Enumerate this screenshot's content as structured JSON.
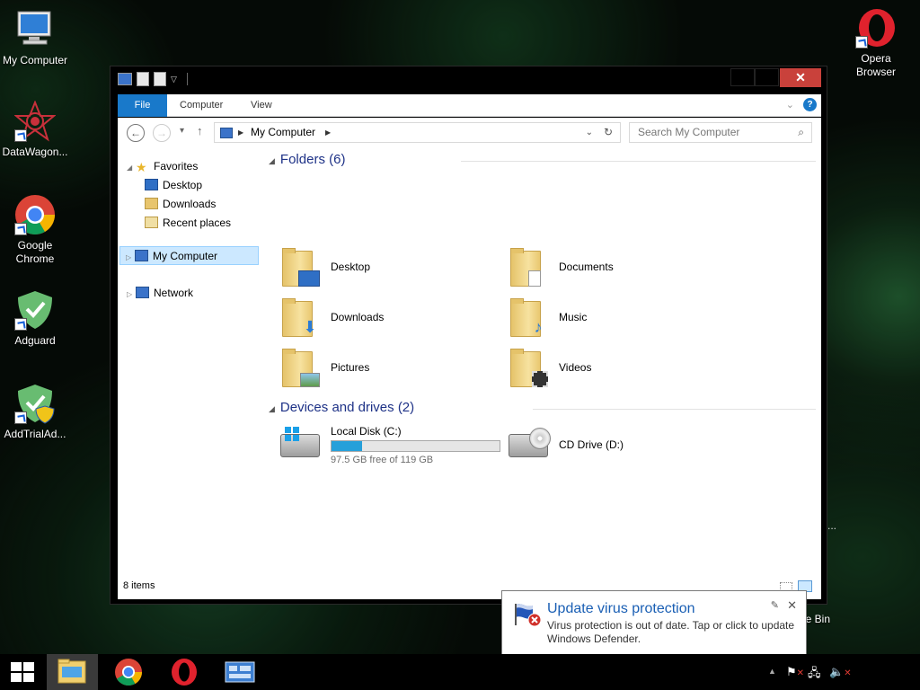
{
  "desktop": {
    "icons": [
      {
        "label": "My Computer"
      },
      {
        "label": "DataWagon..."
      },
      {
        "label": "Google Chrome"
      },
      {
        "label": "Adguard"
      },
      {
        "label": "AddTrialAd..."
      },
      {
        "label": "Opera Browser"
      }
    ],
    "recycle_bin_partial": "le Bin",
    "ellipsis": "..."
  },
  "window": {
    "title_controls": {
      "close": "✕"
    },
    "ribbon": {
      "tabs": [
        "File",
        "Computer",
        "View"
      ]
    },
    "address": {
      "path": "My Computer",
      "search_placeholder": "Search My Computer"
    },
    "nav": {
      "favorites": "Favorites",
      "favorites_items": [
        "Desktop",
        "Downloads",
        "Recent places"
      ],
      "my_computer": "My Computer",
      "network": "Network"
    },
    "folders_header": "Folders (6)",
    "folders": [
      "Desktop",
      "Documents",
      "Downloads",
      "Music",
      "Pictures",
      "Videos"
    ],
    "devices_header": "Devices and drives (2)",
    "drives": [
      {
        "name": "Local Disk (C:)",
        "free_text": "97.5 GB free of 119 GB",
        "used_fraction": 0.18
      },
      {
        "name": "CD Drive (D:)"
      }
    ],
    "status": {
      "item_count": "8 items"
    }
  },
  "toast": {
    "title": "Update virus protection",
    "message": "Virus protection is out of date. Tap or click to update Windows Defender."
  },
  "colors": {
    "accent": "#1979ca",
    "close": "#c9413b",
    "drive_bar": "#26a0da",
    "toast_title": "#1a5fb4"
  }
}
